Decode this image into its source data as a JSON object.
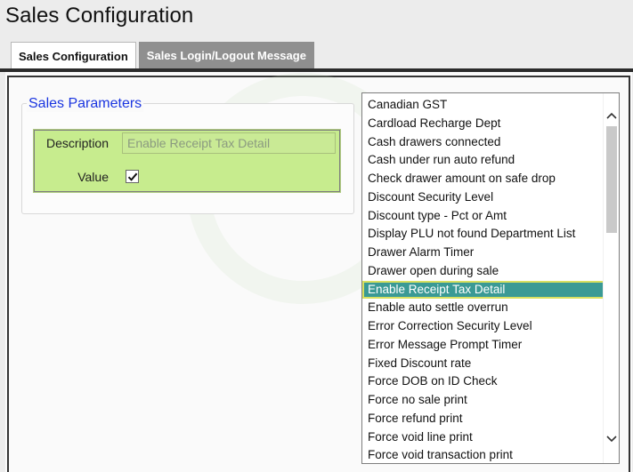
{
  "header": {
    "title": "Sales Configuration"
  },
  "tabs": [
    {
      "label": "Sales Configuration",
      "active": true
    },
    {
      "label": "Sales Login/Logout Message",
      "active": false
    }
  ],
  "params": {
    "legend": "Sales Parameters",
    "description_label": "Description",
    "description_value": "Enable Receipt Tax Detail",
    "value_label": "Value",
    "value_checked": true
  },
  "list": {
    "items": [
      "Canadian GST",
      "Cardload Recharge Dept",
      "Cash drawers connected",
      "Cash under run auto refund",
      "Check drawer amount on safe drop",
      "Discount Security Level",
      "Discount type - Pct or Amt",
      "Display PLU not found Department List",
      "Drawer Alarm Timer",
      "Drawer open during sale",
      "Enable Receipt Tax Detail",
      "Enable auto settle overrun",
      "Error Correction Security Level",
      "Error Message Prompt Timer",
      "Fixed Discount rate",
      "Force DOB on ID Check",
      "Force no sale print",
      "Force refund print",
      "Force void line print",
      "Force void transaction print"
    ],
    "selected_index": 10
  },
  "colors": {
    "accent_blue": "#1a35e0",
    "param_green": "#c7ec8e",
    "selection_teal": "#3a9a95",
    "inactive_tab": "#8f8f8f"
  }
}
